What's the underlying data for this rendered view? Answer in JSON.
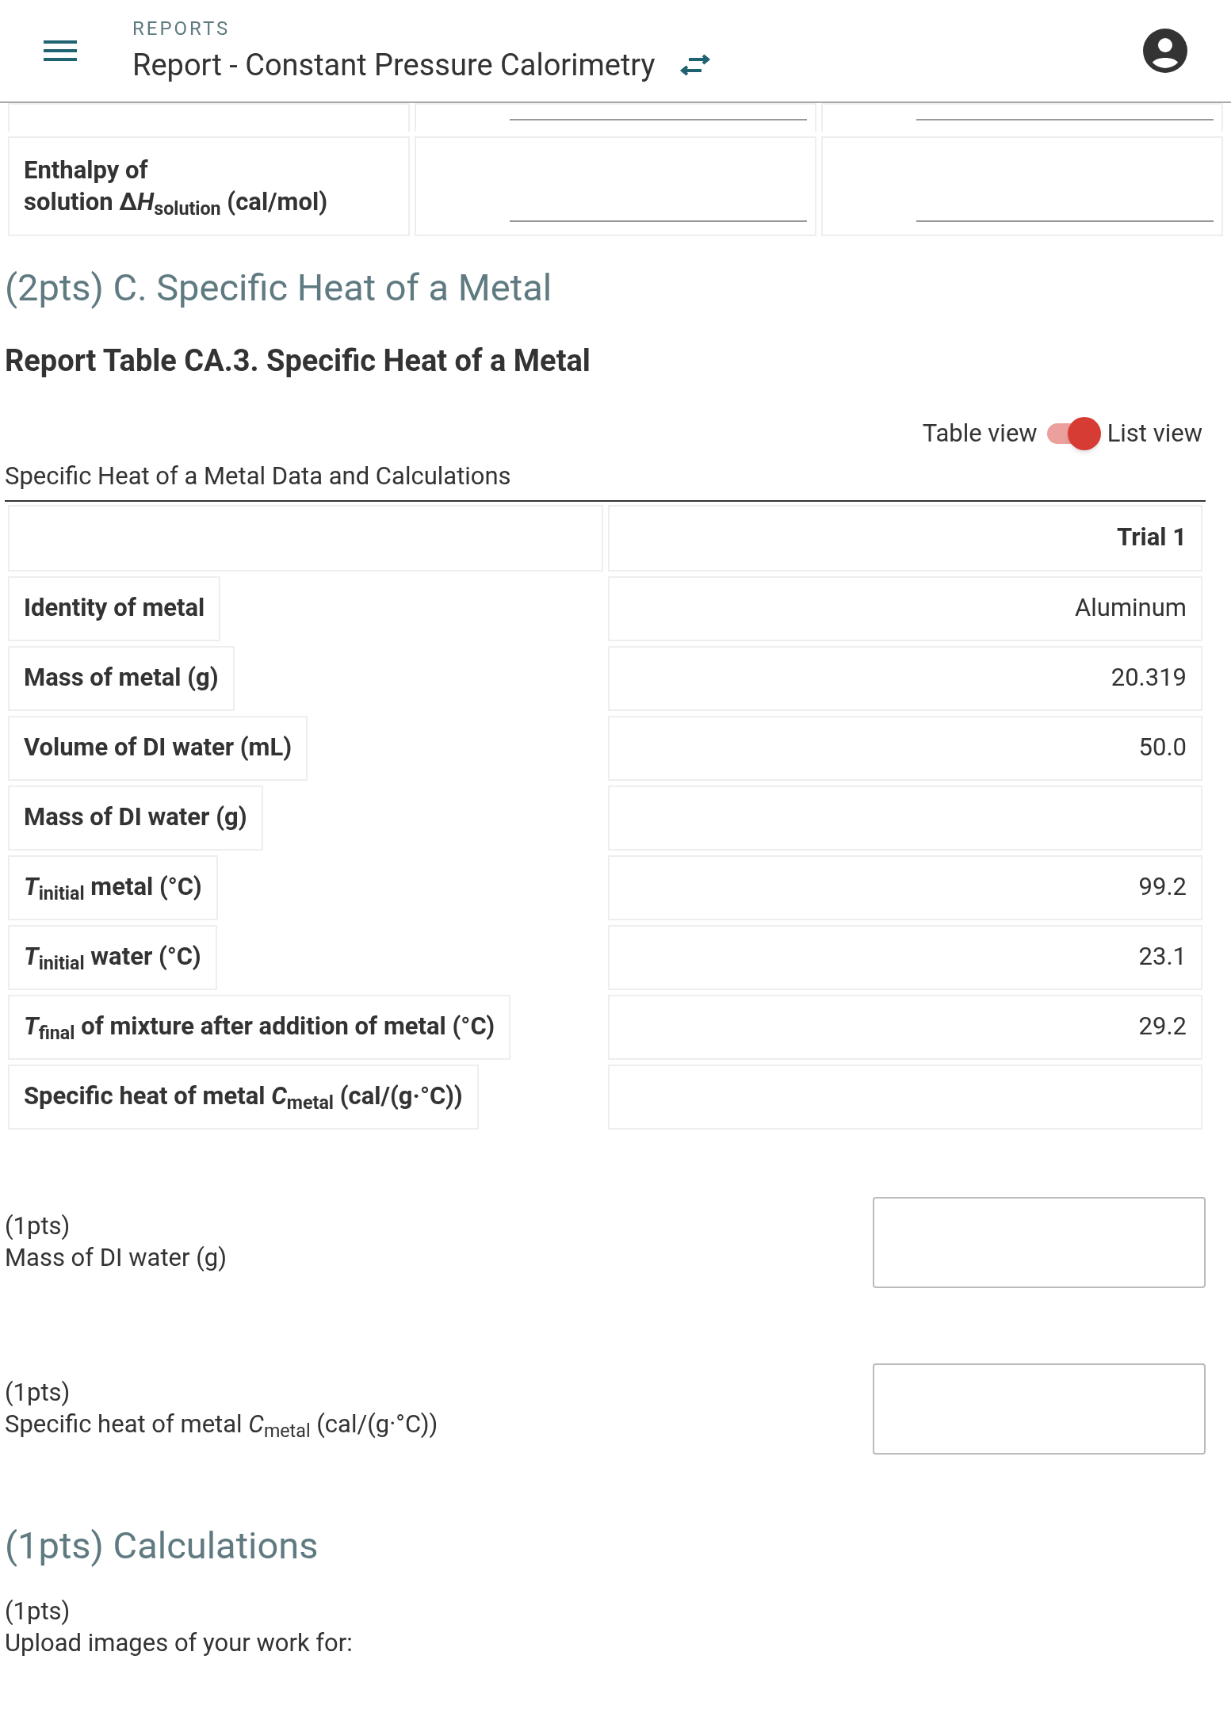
{
  "header": {
    "overline": "REPORTS",
    "title": "Report - Constant Pressure Calorimetry"
  },
  "top_table": {
    "rows": [
      {
        "label_lines": [],
        "partial": true
      },
      {
        "label_lines": [
          [
            "Enthalpy of"
          ],
          [
            "solution Δ",
            "*H*$_{solution}$ (cal/mol)"
          ]
        ],
        "partial": false
      }
    ]
  },
  "section_c": {
    "heading": "(2pts) C. Specific Heat of a Metal",
    "table_title": "Report Table CA.3. Specific Heat of a Metal",
    "toggle": {
      "left_label": "Table view",
      "right_label": "List view",
      "on": true
    },
    "caption": "Specific Heat of a Metal Data and Calculations",
    "columns": [
      "Trial 1"
    ],
    "rows": [
      {
        "label": "Identity of metal",
        "value": "Aluminum"
      },
      {
        "label": "Mass of metal (g)",
        "value": "20.319"
      },
      {
        "label": "Volume of DI water (mL)",
        "value": "50.0"
      },
      {
        "label": "Mass of DI water (g)"
      },
      {
        "label": "*T*$_{initial}$ metal (°C)",
        "value": "99.2"
      },
      {
        "label": "*T*$_{initial}$ water (°C)",
        "value": "23.1"
      },
      {
        "label": "*T*$_{final}$ of mixture after addition of metal (°C)",
        "value": "29.2"
      },
      {
        "label": "Specific heat of metal *C*$_{metal}$ (cal/(g·°C))"
      }
    ],
    "questions": [
      {
        "points": "(1pts)",
        "label": "Mass of DI water (g)"
      },
      {
        "points": "(1pts)",
        "label": "Specific heat of metal *C*$_{metal}$ (cal/(g·°C))"
      }
    ]
  },
  "calculations": {
    "heading": "(1pts) Calculations",
    "points": "(1pts)",
    "label": "Upload images of your work for:"
  }
}
